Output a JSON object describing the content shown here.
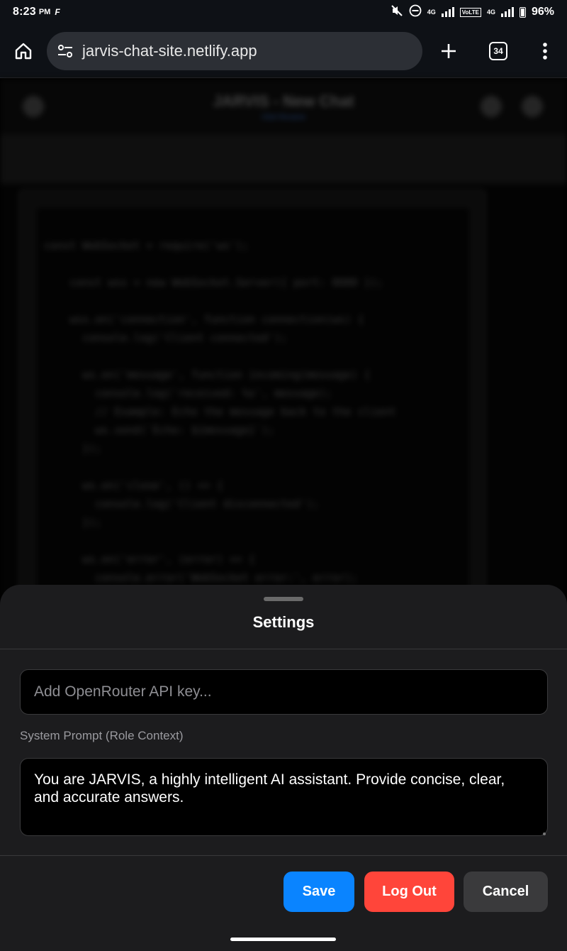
{
  "status_bar": {
    "time": "8:23",
    "ampm": "PM",
    "carrier_glyph": "F",
    "network_1": "4G",
    "volte": "VoLTE",
    "network_2": "4G",
    "battery": "96%"
  },
  "browser": {
    "url": "jarvis-chat-site.netlify.app",
    "tab_count": "34"
  },
  "web_page": {
    "title": "JARVIS - New Chat",
    "subtitle": "Click Rename",
    "code": "const WebSocket = require('ws');\n\n    const wss = new WebSocket.Server({ port: 8080 });\n\n    wss.on('connection', function connection(ws) {\n      console.log('Client connected');\n\n      ws.on('message', function incoming(message) {\n        console.log('received: %s', message);\n        // Example: Echo the message back to the client\n        ws.send(`Echo: ${message}`);\n      });\n\n      ws.on('close', () => {\n        console.log('Client disconnected');\n      });\n\n      ws.on('error', (error) => {\n        console.error('WebSocket error:', error);"
  },
  "settings": {
    "title": "Settings",
    "api_key_value": "",
    "api_key_placeholder": "Add OpenRouter API key...",
    "system_prompt_label": "System Prompt (Role Context)",
    "system_prompt_value": "You are JARVIS, a highly intelligent AI assistant. Provide concise, clear, and accurate answers.",
    "save_label": "Save",
    "logout_label": "Log Out",
    "cancel_label": "Cancel"
  },
  "colors": {
    "save": "#0a84ff",
    "logout": "#ff453a",
    "cancel": "#3a3a3c",
    "sheet_bg": "#1c1c1e"
  }
}
